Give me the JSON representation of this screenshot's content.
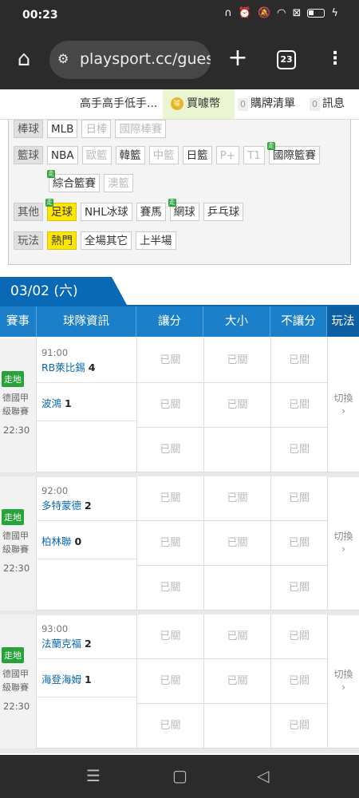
{
  "status": {
    "time": "00:23",
    "battery": "▮"
  },
  "browser": {
    "url": "playsport.cc/gues",
    "tab_count": "23"
  },
  "topnav": {
    "experts": "高手高手低手...",
    "coins": "買噱幣",
    "cart_count": "0",
    "cart": "購牌清單",
    "msg_count": "0",
    "msg": "訊息"
  },
  "filters": {
    "baseball": {
      "label": "棒球",
      "items": [
        "MLB",
        "日棒",
        "國際棒賽"
      ]
    },
    "basketball": {
      "label": "籃球",
      "items": [
        "NBA",
        "歐籃",
        "韓籃",
        "中籃",
        "日籃",
        "P+",
        "T1",
        "國際籃賽",
        "綜合籃賽",
        "澳籃"
      ]
    },
    "other": {
      "label": "其他",
      "items": [
        "足球",
        "NHL冰球",
        "賽馬",
        "網球",
        "乒乓球"
      ]
    },
    "play": {
      "label": "玩法",
      "items": [
        "熱門",
        "全場其它",
        "上半場"
      ]
    },
    "badge": "走"
  },
  "date": "03/02 (六)",
  "table_headers": [
    "賽事",
    "球隊資訊",
    "讓分",
    "大小",
    "不讓分",
    "玩法"
  ],
  "closed_label": "已關",
  "switch_label": "切換",
  "matches": [
    {
      "badge": "走地",
      "league": "德國甲級聯賽",
      "time": "22:30",
      "kick": "91:00",
      "home": "RB萊比錫",
      "home_score": "4",
      "away": "波鴻",
      "away_score": "1"
    },
    {
      "badge": "走地",
      "league": "德國甲級聯賽",
      "time": "22:30",
      "kick": "92:00",
      "home": "多特蒙德",
      "home_score": "2",
      "away": "柏林聯",
      "away_score": "0"
    },
    {
      "badge": "走地",
      "league": "德國甲級聯賽",
      "time": "22:30",
      "kick": "93:00",
      "home": "法蘭克福",
      "home_score": "2",
      "away": "海登海姆",
      "away_score": "1"
    }
  ]
}
